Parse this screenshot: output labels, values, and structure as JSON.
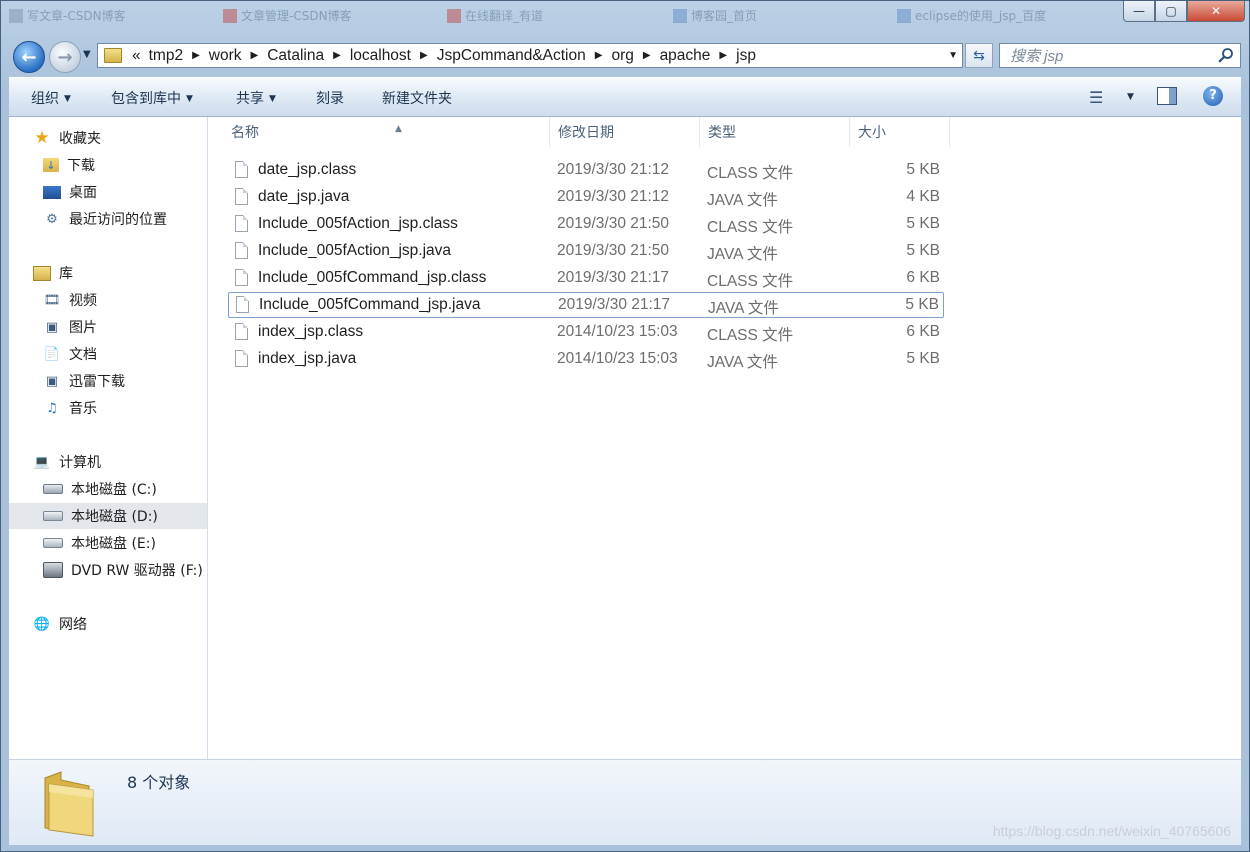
{
  "background_tabs": [
    "写文章-CSDN博客",
    "文章管理-CSDN博客",
    "在线翻译_有道",
    "博客园_首页",
    "eclipse的使用_jsp_百度"
  ],
  "window_controls": {
    "minimize": "—",
    "maximize": "▢",
    "close": "✕"
  },
  "address": {
    "overflow": "«",
    "crumbs": [
      "tmp2",
      "work",
      "Catalina",
      "localhost",
      "JspCommand&Action",
      "org",
      "apache",
      "jsp"
    ]
  },
  "search": {
    "placeholder": "搜索 jsp"
  },
  "toolbar": {
    "organize": "组织",
    "include_in_library": "包含到库中",
    "share": "共享",
    "burn": "刻录",
    "new_folder": "新建文件夹"
  },
  "nav": {
    "favorites": "收藏夹",
    "favorites_items": [
      "下载",
      "桌面",
      "最近访问的位置"
    ],
    "libraries": "库",
    "library_items": [
      "视频",
      "图片",
      "文档",
      "迅雷下载",
      "音乐"
    ],
    "computer": "计算机",
    "computer_items": [
      "本地磁盘 (C:)",
      "本地磁盘 (D:)",
      "本地磁盘 (E:)",
      "DVD RW 驱动器 (F:)"
    ],
    "network": "网络"
  },
  "columns": {
    "name": "名称",
    "modified": "修改日期",
    "type": "类型",
    "size": "大小"
  },
  "files": [
    {
      "name": "date_jsp.class",
      "modified": "2019/3/30 21:12",
      "type": "CLASS 文件",
      "size": "5 KB"
    },
    {
      "name": "date_jsp.java",
      "modified": "2019/3/30 21:12",
      "type": "JAVA 文件",
      "size": "4 KB"
    },
    {
      "name": "Include_005fAction_jsp.class",
      "modified": "2019/3/30 21:50",
      "type": "CLASS 文件",
      "size": "5 KB"
    },
    {
      "name": "Include_005fAction_jsp.java",
      "modified": "2019/3/30 21:50",
      "type": "JAVA 文件",
      "size": "5 KB"
    },
    {
      "name": "Include_005fCommand_jsp.class",
      "modified": "2019/3/30 21:17",
      "type": "CLASS 文件",
      "size": "6 KB"
    },
    {
      "name": "Include_005fCommand_jsp.java",
      "modified": "2019/3/30 21:17",
      "type": "JAVA 文件",
      "size": "5 KB"
    },
    {
      "name": "index_jsp.class",
      "modified": "2014/10/23 15:03",
      "type": "CLASS 文件",
      "size": "6 KB"
    },
    {
      "name": "index_jsp.java",
      "modified": "2014/10/23 15:03",
      "type": "JAVA 文件",
      "size": "5 KB"
    }
  ],
  "status": {
    "item_count": "8 个对象"
  },
  "watermark": "https://blog.csdn.net/weixin_40765606"
}
